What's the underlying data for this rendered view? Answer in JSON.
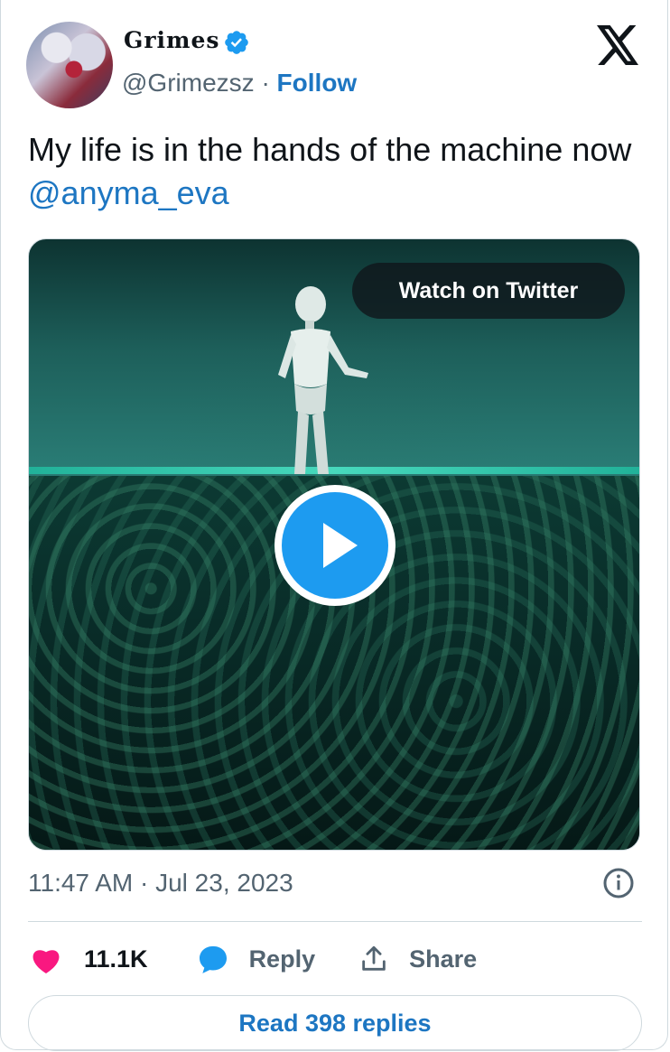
{
  "author": {
    "display_name": "Grimes",
    "handle": "@Grimezsz",
    "separator": "·",
    "follow_label": "Follow",
    "verified": true
  },
  "tweet": {
    "text": "My life is in the hands of the machine now ",
    "mention": "@anyma_eva",
    "timestamp": "11:47 AM · Jul 23, 2023"
  },
  "media": {
    "watch_label": "Watch on Twitter"
  },
  "actions": {
    "likes": "11.1K",
    "reply_label": "Reply",
    "share_label": "Share",
    "read_replies_label": "Read 398 replies"
  },
  "colors": {
    "link": "#1d76c2",
    "like": "#f91880",
    "play": "#1d9bf0",
    "muted": "#536471"
  }
}
